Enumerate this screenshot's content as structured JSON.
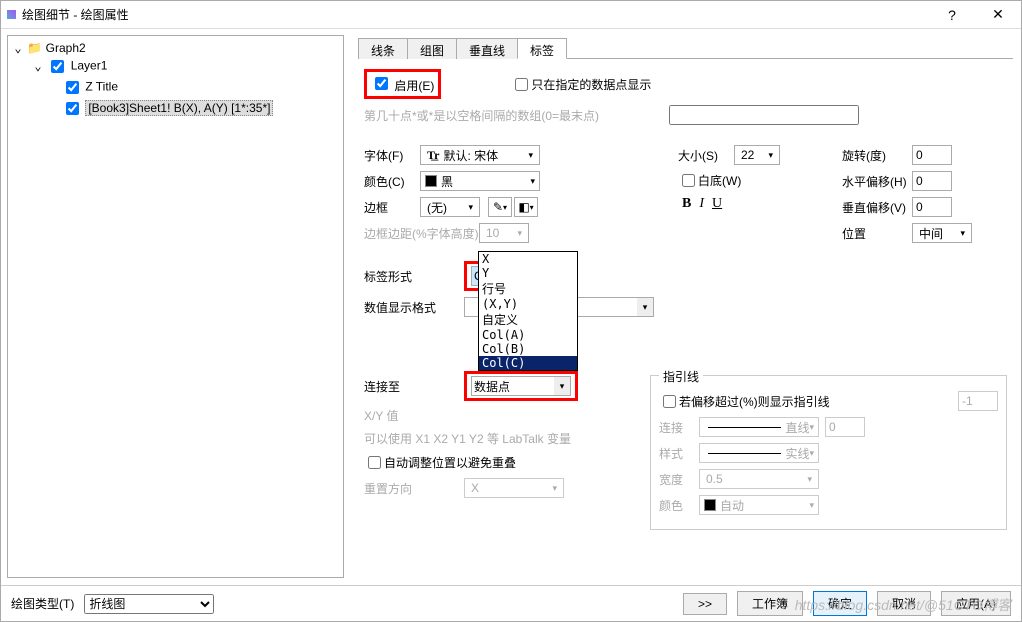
{
  "title": "绘图细节 - 绘图属性",
  "tree": {
    "root": "Graph2",
    "layer": "Layer1",
    "ztitle": "Z Title",
    "dataset": "[Book3]Sheet1! B(X), A(Y) [1*:35*]"
  },
  "tabs": [
    "线条",
    "组图",
    "垂直线",
    "标签"
  ],
  "enable": "启用(E)",
  "onlyAtPoints": "只在指定的数据点显示",
  "hintGray": "第几十点*或*是以空格间隔的数组(0=最末点)",
  "fonts": {
    "fontLabel": "字体(F)",
    "fontValue": "默认: 宋体",
    "colorLabel": "颜色(C)",
    "colorValue": "黑",
    "borderLabel": "边框",
    "borderValue": "(无)",
    "borderMarginLabel": "边框边距(%字体高度)",
    "borderMarginValue": "10",
    "sizeLabel": "大小(S)",
    "sizeValue": "22",
    "whiteBgLabel": "白底(W)",
    "rotateLabel": "旋转(度)",
    "rotateValue": "0",
    "hoffLabel": "水平偏移(H)",
    "hoffValue": "0",
    "voffLabel": "垂直偏移(V)",
    "voffValue": "0",
    "posLabel": "位置",
    "posValue": "中间"
  },
  "labelForm": {
    "label": "标签形式",
    "value": "Col(C)",
    "options": [
      "X",
      "Y",
      "行号",
      "(X,Y)",
      "自定义",
      "Col(A)",
      "Col(B)",
      "Col(C)"
    ]
  },
  "numFormat": "数值显示格式",
  "connectTo": {
    "label": "连接至",
    "value": "数据点"
  },
  "xyValueLabel": "X/Y 值",
  "labtalkHint": "可以使用 X1 X2 Y1 Y2 等 LabTalk 变量",
  "autoAdjust": "自动调整位置以避免重叠",
  "resetDir": {
    "label": "重置方向",
    "value": "X"
  },
  "leader": {
    "title": "指引线",
    "showIf": "若偏移超过(%)则显示指引线",
    "showIfVal": "-1",
    "connectLabel": "连接",
    "connectValue": "直线",
    "connectN": "0",
    "styleLabel": "样式",
    "styleValue": "实线",
    "widthLabel": "宽度",
    "widthValue": "0.5",
    "colorLabel": "颜色",
    "colorValue": "自动"
  },
  "footer": {
    "typeLabel": "绘图类型(T)",
    "typeValue": "折线图",
    "more": ">>",
    "workbook": "工作簿",
    "ok": "确定",
    "cancel": "取消",
    "apply": "应用(A)"
  },
  "watermark": "https://blog.csdn.net/@51CTO博客"
}
